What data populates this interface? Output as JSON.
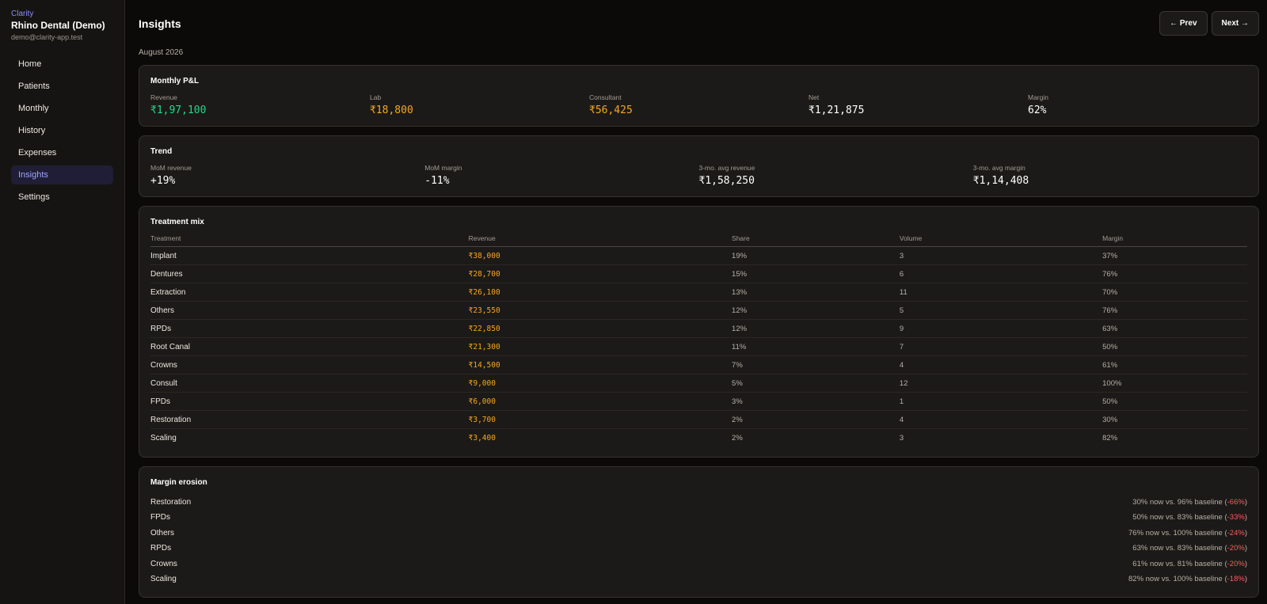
{
  "sidebar": {
    "brand": "Clarity",
    "org": "Rhino Dental (Demo)",
    "email": "demo@clarity-app.test",
    "items": [
      {
        "label": "Home"
      },
      {
        "label": "Patients"
      },
      {
        "label": "Monthly"
      },
      {
        "label": "History"
      },
      {
        "label": "Expenses"
      },
      {
        "label": "Insights",
        "active": true
      },
      {
        "label": "Settings"
      }
    ]
  },
  "header": {
    "title": "Insights",
    "period": "August 2026",
    "prev_label": "← Prev",
    "next_label": "Next →"
  },
  "pnl": {
    "title": "Monthly P&L",
    "stats": [
      {
        "label": "Revenue",
        "value": "₹1,97,100",
        "color": "#22d98a"
      },
      {
        "label": "Lab",
        "value": "₹18,800",
        "color": "#f6a623"
      },
      {
        "label": "Consultant",
        "value": "₹56,425",
        "color": "#f6a623"
      },
      {
        "label": "Net",
        "value": "₹1,21,875"
      },
      {
        "label": "Margin",
        "value": "62%"
      }
    ]
  },
  "trend": {
    "title": "Trend",
    "stats": [
      {
        "label": "MoM revenue",
        "value": "+19%"
      },
      {
        "label": "MoM margin",
        "value": "-11%"
      },
      {
        "label": "3-mo. avg revenue",
        "value": "₹1,58,250"
      },
      {
        "label": "3-mo. avg margin",
        "value": "₹1,14,408"
      }
    ]
  },
  "mix": {
    "title": "Treatment mix",
    "columns": [
      "Treatment",
      "Revenue",
      "Share",
      "Volume",
      "Margin"
    ],
    "rows": [
      [
        "Implant",
        "₹38,000",
        "19%",
        "3",
        "37%"
      ],
      [
        "Dentures",
        "₹28,700",
        "15%",
        "6",
        "76%"
      ],
      [
        "Extraction",
        "₹26,100",
        "13%",
        "11",
        "70%"
      ],
      [
        "Others",
        "₹23,550",
        "12%",
        "5",
        "76%"
      ],
      [
        "RPDs",
        "₹22,850",
        "12%",
        "9",
        "63%"
      ],
      [
        "Root Canal",
        "₹21,300",
        "11%",
        "7",
        "50%"
      ],
      [
        "Crowns",
        "₹14,500",
        "7%",
        "4",
        "61%"
      ],
      [
        "Consult",
        "₹9,000",
        "5%",
        "12",
        "100%"
      ],
      [
        "FPDs",
        "₹6,000",
        "3%",
        "1",
        "50%"
      ],
      [
        "Restoration",
        "₹3,700",
        "2%",
        "4",
        "30%"
      ],
      [
        "Scaling",
        "₹3,400",
        "2%",
        "3",
        "82%"
      ]
    ]
  },
  "erosion": {
    "title": "Margin erosion",
    "rows": [
      {
        "name": "Restoration",
        "text": "30% now vs. 96% baseline (",
        "delta": "-66%",
        "close": ")"
      },
      {
        "name": "FPDs",
        "text": "50% now vs. 83% baseline (",
        "delta": "-33%",
        "close": ")"
      },
      {
        "name": "Others",
        "text": "76% now vs. 100% baseline (",
        "delta": "-24%",
        "close": ")"
      },
      {
        "name": "RPDs",
        "text": "63% now vs. 83% baseline (",
        "delta": "-20%",
        "close": ")"
      },
      {
        "name": "Crowns",
        "text": "61% now vs. 81% baseline (",
        "delta": "-20%",
        "close": ")"
      },
      {
        "name": "Scaling",
        "text": "82% now vs. 100% baseline (",
        "delta": "-18%",
        "close": ")"
      }
    ]
  }
}
